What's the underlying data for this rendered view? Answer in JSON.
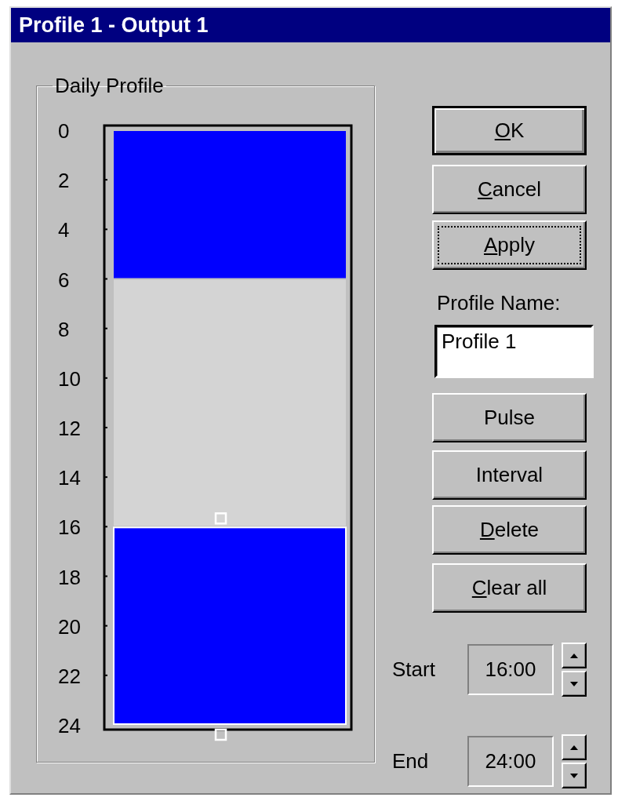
{
  "window": {
    "title": "Profile 1 - Output 1"
  },
  "daily_profile": {
    "title": "Daily Profile",
    "blocks": [
      {
        "selected": false
      },
      {
        "selected": false
      },
      {
        "selected": true
      }
    ],
    "chart_data": {
      "type": "bar",
      "stacked": true,
      "orientation": "vertical",
      "categories": [
        null
      ],
      "ylim": [
        24,
        0
      ],
      "yticks": [
        0,
        2,
        4,
        6,
        8,
        10,
        12,
        14,
        16,
        18,
        20,
        22,
        24
      ],
      "series": [
        {
          "color": "#0000ff",
          "values": [
            6
          ]
        },
        {
          "color": "#d4d4d4",
          "values": [
            10
          ]
        },
        {
          "color": "#0000ff",
          "values": [
            8
          ]
        }
      ]
    }
  },
  "buttons_top": [
    {
      "label": "OK",
      "underline_first": true,
      "default": true,
      "focused": false
    },
    {
      "label": "Cancel",
      "underline_first": true,
      "default": false,
      "focused": false
    },
    {
      "label": "Apply",
      "underline_first": true,
      "default": false,
      "focused": true
    }
  ],
  "profile_name": {
    "label": "Profile Name:",
    "value": "Profile 1"
  },
  "buttons_bottom": [
    {
      "label": "Pulse",
      "underline_first": false,
      "default": false,
      "focused": false
    },
    {
      "label": "Interval",
      "underline_first": false,
      "default": false,
      "focused": false
    },
    {
      "label": "Delete",
      "underline_first": true,
      "default": false,
      "focused": false
    },
    {
      "label": "Clear all",
      "underline_first": true,
      "default": false,
      "focused": false
    }
  ],
  "times": [
    {
      "label": "Start",
      "value": "16:00"
    },
    {
      "label": "End",
      "value": "24:00"
    }
  ]
}
